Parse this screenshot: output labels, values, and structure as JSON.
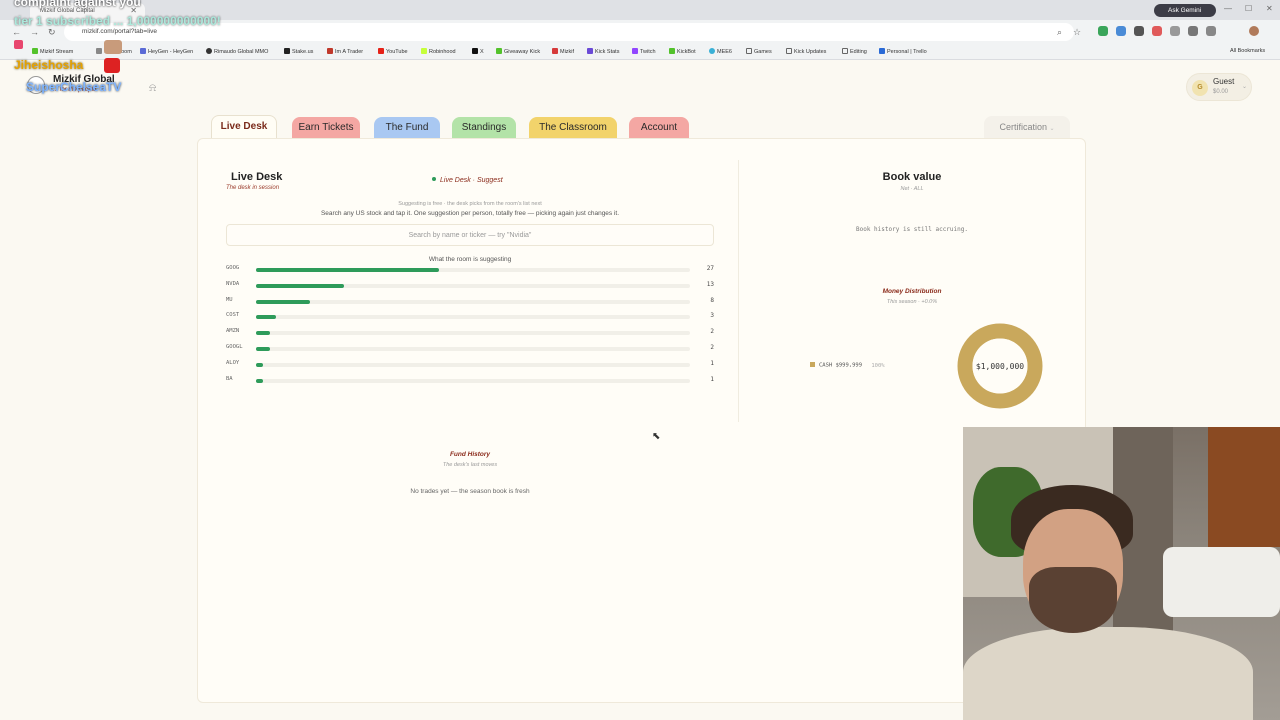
{
  "browser": {
    "tab_title": "Mizkif Global Capital",
    "url": "mizkif.com/portal?tab=live",
    "ask_gemini": "Ask Gemini",
    "bookmarks": [
      "Mizkif Stream",
      "No... Room",
      "HeyGen - HeyGen",
      "Rimaudo Global MMO",
      "Stake.us",
      "Im A Trader",
      "YouTube",
      "Robinhood",
      "X",
      "Giveaway Kick",
      "Mizkif",
      "Kick Stats",
      "Twitch",
      "KickBot",
      "MEE6",
      "Games",
      "Kick Updates",
      "Editing",
      "Personal | Trello"
    ],
    "all_bookmarks": "All Bookmarks"
  },
  "overlay": {
    "complaint": "complaint against you",
    "alert": "tier 1 subscribed ... 1,000000000000!",
    "name1": "Jiheishosha",
    "name2": "SuperChelseaTV"
  },
  "header": {
    "brand": "Mizkif Global",
    "tagline": "... for the people",
    "user_name": "Guest",
    "user_balance": "$0.00",
    "user_initial": "G"
  },
  "tabs": [
    {
      "label": "Live Desk",
      "color": "#fffdf5"
    },
    {
      "label": "Earn Tickets",
      "color": "#f4a7a3"
    },
    {
      "label": "The Fund",
      "color": "#a9c8f2"
    },
    {
      "label": "Standings",
      "color": "#b3e3a8"
    },
    {
      "label": "The Classroom",
      "color": "#f2d36b"
    },
    {
      "label": "Account",
      "color": "#f4a7a3"
    }
  ],
  "certification": "Certification",
  "live_desk": {
    "title": "Live Desk",
    "subtitle": "The desk in session",
    "status": "Live Desk · Suggest",
    "small_note": "Suggesting is free · the desk picks from the room's list next",
    "main_note": "Search any US stock and tap it. One suggestion per person, totally free — picking again just changes it.",
    "search_placeholder": "Search by name or ticker — try \"Nvidia\"",
    "room_label": "What the room is suggesting",
    "max": 64,
    "suggestions": [
      {
        "ticker": "GOOG",
        "count": "27",
        "value": 27
      },
      {
        "ticker": "NVDA",
        "count": "13",
        "value": 13
      },
      {
        "ticker": "MU",
        "count": "8",
        "value": 8
      },
      {
        "ticker": "COST",
        "count": "3",
        "value": 3
      },
      {
        "ticker": "AMZN",
        "count": "2",
        "value": 2
      },
      {
        "ticker": "GOOGL",
        "count": "2",
        "value": 2
      },
      {
        "ticker": "ALOY",
        "count": "1",
        "value": 1
      },
      {
        "ticker": "BA",
        "count": "1",
        "value": 1
      }
    ]
  },
  "book": {
    "title": "Book value",
    "subtitle": "Net · ALL",
    "note": "Book history is still accruing.",
    "dist_title": "Money Distribution",
    "dist_subtitle": "This season · +0.0%",
    "legend_label": "CASH",
    "legend_value": "$999,999",
    "legend_pct": "100%",
    "center_value": "$1,000,000",
    "donut_color": "#c9a85c"
  },
  "fund_history": {
    "title": "Fund History",
    "subtitle": "The desk's last moves",
    "note": "No trades yet — the season book is fresh"
  }
}
